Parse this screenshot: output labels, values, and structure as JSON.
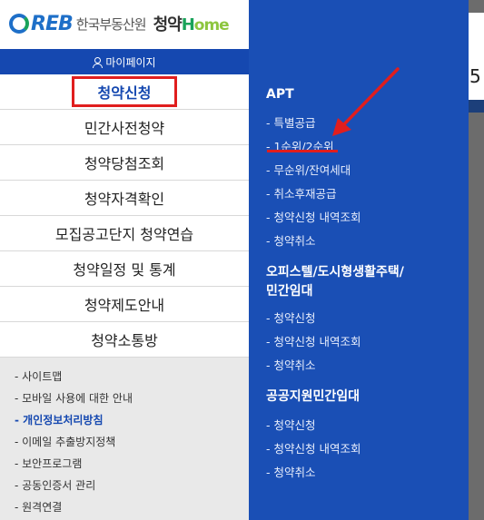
{
  "logo": {
    "reb": "REB",
    "org": "한국부동산원",
    "home_prefix": "청약",
    "home_h": "H",
    "home_rest": "ome"
  },
  "mypage": {
    "label": "마이페이지"
  },
  "menu": [
    "청약신청",
    "민간사전청약",
    "청약당첨조회",
    "청약자격확인",
    "모집공고단지 청약연습",
    "청약일정 및 통계",
    "청약제도안내",
    "청약소통방"
  ],
  "sub_links": [
    "- 사이트맵",
    "- 모바일 사용에 대한 안내",
    "- 개인정보처리방침",
    "- 이메일 추출방지정책",
    "- 보안프로그램",
    "- 공동인증서 관리",
    "- 원격연결"
  ],
  "panel": {
    "sections": [
      {
        "title": "APT",
        "links": [
          "- 특별공급",
          "- 1순위/2순위",
          "- 무순위/잔여세대",
          "- 취소후재공급",
          "- 청약신청 내역조회",
          "- 청약취소"
        ]
      },
      {
        "title_line1": "오피스텔/도시형생활주택/",
        "title_line2": "민간임대",
        "links": [
          "- 청약신청",
          "- 청약신청 내역조회",
          "- 청약취소"
        ]
      },
      {
        "title": "공공지원민간임대",
        "links": [
          "- 청약신청",
          "- 청약신청 내역조회",
          "- 청약취소"
        ]
      }
    ]
  },
  "sliver": {
    "digit": "5"
  },
  "colors": {
    "panel_bg": "#1a4fb5",
    "mypage_bg": "#1548b0",
    "highlight": "#e01e1e"
  }
}
